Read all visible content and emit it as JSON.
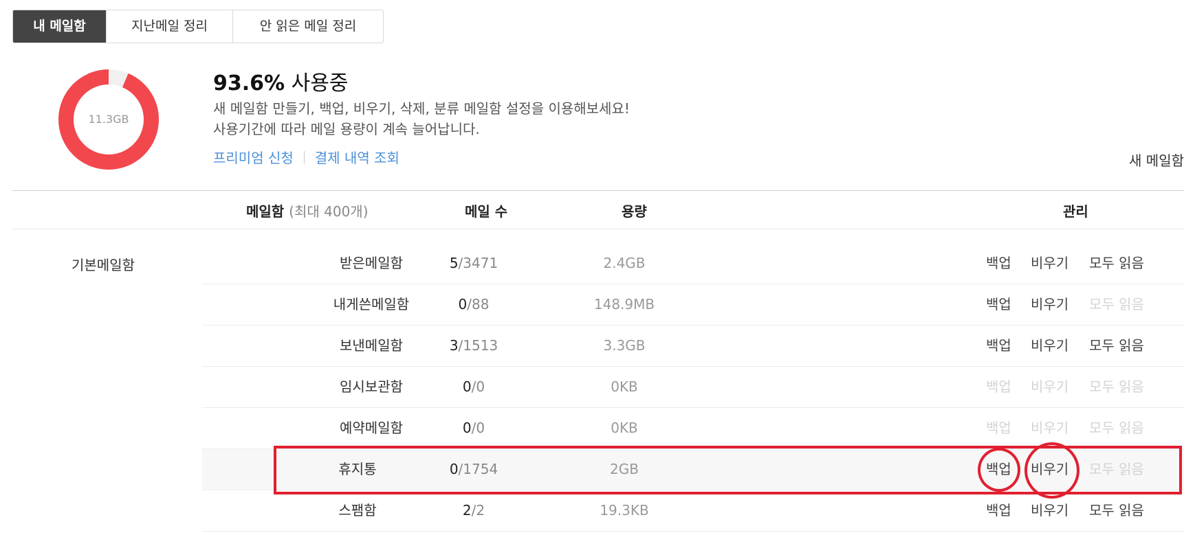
{
  "tabs": [
    {
      "label": "내 메일함",
      "active": true
    },
    {
      "label": "지난메일 정리",
      "active": false
    },
    {
      "label": "안 읽은 메일 정리",
      "active": false
    }
  ],
  "storage": {
    "used_percent": 93.6,
    "total_label": "11.3GB",
    "usage_number": "93.6%",
    "usage_text": "사용중",
    "desc1": "새 메일함 만들기, 백업, 비우기, 삭제, 분류 메일함 설정을 이용해보세요!",
    "desc2": "사용기간에 따라 메일 용량이 계속 늘어납니다.",
    "link_premium": "프리미엄 신청",
    "link_payment": "결제 내역 조회",
    "new_mailbox": "새 메일함"
  },
  "colors": {
    "donut_used": "#f2474d",
    "donut_free": "#f0f0f0",
    "highlight": "#e02030",
    "link": "#4a90d9"
  },
  "table": {
    "header_mailbox": "메일함",
    "header_mailbox_sub": "(최대 400개)",
    "header_count": "메일 수",
    "header_size": "용량",
    "header_manage": "관리",
    "section_label": "기본메일함",
    "rows": [
      {
        "name": "받은메일함",
        "unread": "5",
        "total": "/3471",
        "size": "2.4GB",
        "backup": "백업",
        "empty": "비우기",
        "readall": "모두 읽음"
      },
      {
        "name": "내게쓴메일함",
        "unread": "0",
        "total": "/88",
        "size": "148.9MB",
        "backup": "백업",
        "empty": "비우기",
        "readall": "모두 읽음"
      },
      {
        "name": "보낸메일함",
        "unread": "3",
        "total": "/1513",
        "size": "3.3GB",
        "backup": "백업",
        "empty": "비우기",
        "readall": "모두 읽음"
      },
      {
        "name": "임시보관함",
        "unread": "0",
        "total": "/0",
        "size": "0KB",
        "backup": "백업",
        "empty": "비우기",
        "readall": "모두 읽음"
      },
      {
        "name": "예약메일함",
        "unread": "0",
        "total": "/0",
        "size": "0KB",
        "backup": "백업",
        "empty": "비우기",
        "readall": "모두 읽음"
      },
      {
        "name": "휴지통",
        "unread": "0",
        "total": "/1754",
        "size": "2GB",
        "backup": "백업",
        "empty": "비우기",
        "readall": "모두 읽음"
      },
      {
        "name": "스팸함",
        "unread": "2",
        "total": "/2",
        "size": "19.3KB",
        "backup": "백업",
        "empty": "비우기",
        "readall": "모두 읽음"
      }
    ]
  }
}
